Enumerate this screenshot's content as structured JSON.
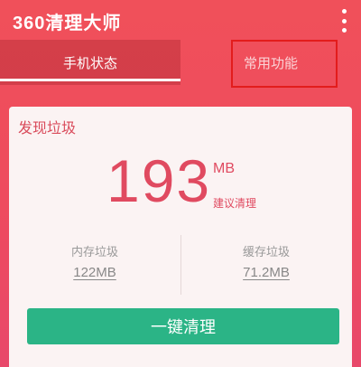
{
  "app": {
    "title": "360清理大师"
  },
  "tabs": [
    {
      "label": "手机状态",
      "active": true
    },
    {
      "label": "常用功能",
      "active": false
    }
  ],
  "card": {
    "title": "发现垃圾",
    "total_value": "193",
    "total_unit": "MB",
    "suggest_label": "建议清理",
    "memory": {
      "label": "内存垃圾",
      "value": "122MB"
    },
    "cache": {
      "label": "缓存垃圾",
      "value": "71.2MB"
    },
    "clean_button": "一键清理"
  },
  "colors": {
    "header_red": "#f0505a",
    "accent_pink": "#e04a60",
    "button_green": "#2bb486",
    "highlight_box": "#e31c1c"
  },
  "icons": {
    "menu": "more-vertical-icon"
  }
}
